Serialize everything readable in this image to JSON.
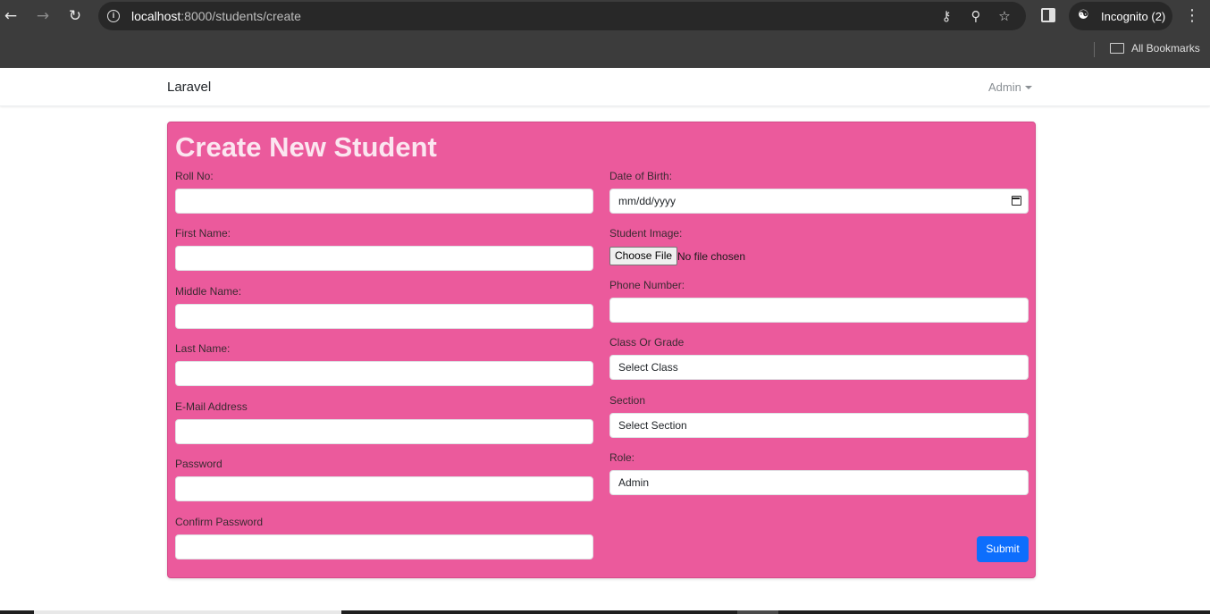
{
  "browser": {
    "url_host": "localhost",
    "url_rest": ":8000/students/create",
    "incognito_label": "Incognito (2)",
    "bookmarks_label": "All Bookmarks",
    "icons": [
      "back-icon",
      "forward-icon",
      "reload-icon",
      "info-icon",
      "key-icon",
      "zoom-icon",
      "star-icon",
      "side-panel-icon",
      "incognito-icon",
      "menu-icon",
      "folder-icon"
    ]
  },
  "navbar": {
    "brand": "Laravel",
    "user": "Admin"
  },
  "form": {
    "title": "Create New Student",
    "left": {
      "roll_no_label": "Roll No:",
      "first_name_label": "First Name:",
      "middle_name_label": "Middle Name:",
      "last_name_label": "Last Name:",
      "email_label": "E-Mail Address",
      "password_label": "Password",
      "confirm_password_label": "Confirm Password"
    },
    "right": {
      "dob_label": "Date of Birth:",
      "dob_placeholder": "mm/dd/yyyy",
      "image_label": "Student Image:",
      "file_button": "Choose File",
      "file_status": "No file chosen",
      "phone_label": "Phone Number:",
      "class_label": "Class Or Grade",
      "class_value": "Select Class",
      "section_label": "Section",
      "section_value": "Select Section",
      "role_label": "Role:",
      "role_value": "Admin"
    },
    "submit_label": "Submit"
  },
  "colors": {
    "card_background": "#eb5a9c",
    "submit_button": "#0d6efd",
    "browser_chrome": "#3c3c3c"
  }
}
